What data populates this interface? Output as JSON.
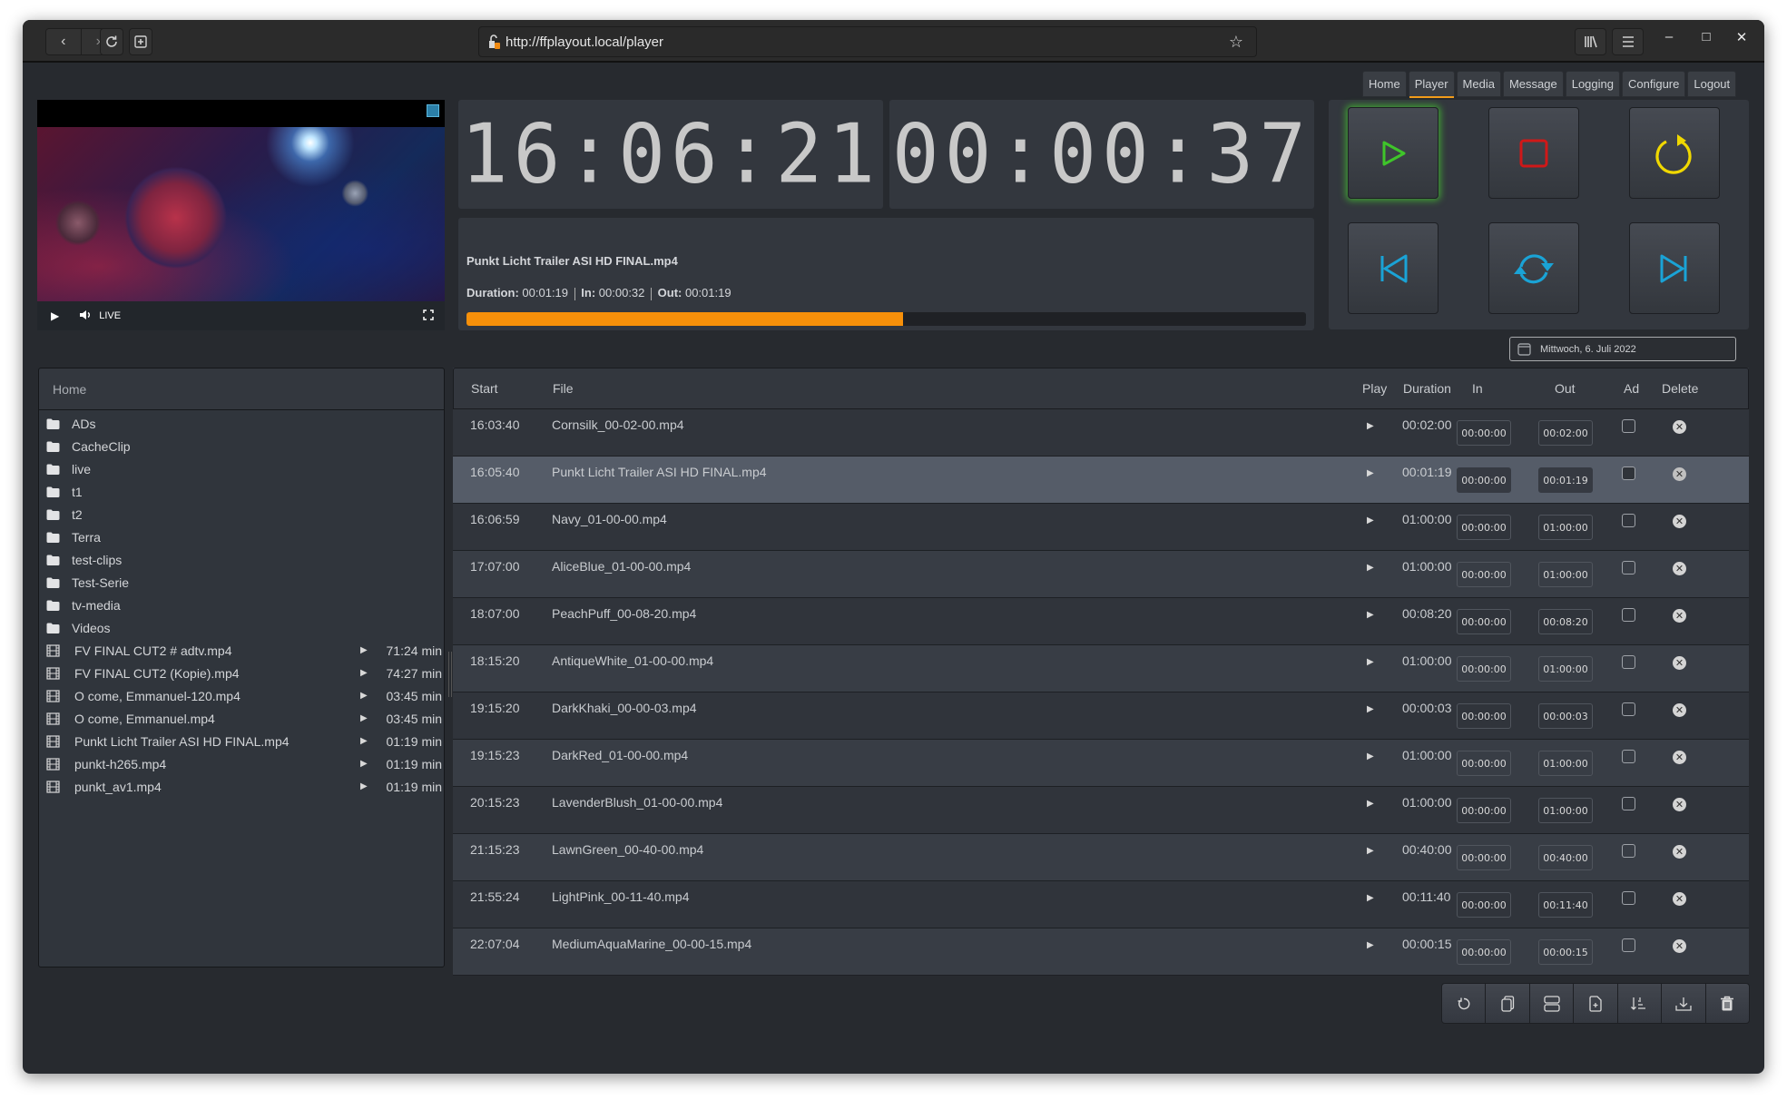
{
  "browser": {
    "url": "http://ffplayout.local/player",
    "nav": {
      "back": "back-icon",
      "forward": "forward-icon",
      "reload": "reload-icon",
      "new_tab": "new-tab-icon"
    },
    "right_icons": [
      "library-icon",
      "menu-icon"
    ],
    "window_controls": [
      "minimize",
      "maximize",
      "close"
    ]
  },
  "nav_tabs": [
    {
      "label": "Home",
      "active": false
    },
    {
      "label": "Player",
      "active": true
    },
    {
      "label": "Media",
      "active": false
    },
    {
      "label": "Message",
      "active": false
    },
    {
      "label": "Logging",
      "active": false
    },
    {
      "label": "Configure",
      "active": false
    },
    {
      "label": "Logout",
      "active": false
    }
  ],
  "preview": {
    "live_label": "LIVE"
  },
  "clocks": {
    "current_time": "16:06:21",
    "remaining": "00:00:37"
  },
  "now_playing": {
    "title": "Punkt Licht Trailer ASI HD FINAL.mp4",
    "duration_label": "Duration:",
    "duration": "00:01:19",
    "in_label": "In:",
    "in": "00:00:32",
    "out_label": "Out:",
    "out": "00:01:19",
    "progress_percent": 52
  },
  "controls": {
    "buttons": [
      {
        "name": "play",
        "color": "#3fc52a"
      },
      {
        "name": "stop",
        "color": "#d01818"
      },
      {
        "name": "restart",
        "color": "#f0d800"
      },
      {
        "name": "previous",
        "color": "#1aa3d6"
      },
      {
        "name": "reset",
        "color": "#1aa3d6"
      },
      {
        "name": "next",
        "color": "#1aa3d6"
      }
    ]
  },
  "date_picker": {
    "value": "Mittwoch, 6. Juli 2022"
  },
  "media_browser": {
    "path": "Home",
    "folders": [
      "ADs",
      "CacheClip",
      "live",
      "t1",
      "t2",
      "Terra",
      "test-clips",
      "Test-Serie",
      "tv-media",
      "Videos"
    ],
    "files": [
      {
        "name": "FV FINAL CUT2 # adtv.mp4",
        "duration": "71:24 min"
      },
      {
        "name": "FV FINAL CUT2 (Kopie).mp4",
        "duration": "74:27 min"
      },
      {
        "name": "O come, Emmanuel-120.mp4",
        "duration": "03:45 min"
      },
      {
        "name": "O come, Emmanuel.mp4",
        "duration": "03:45 min"
      },
      {
        "name": "Punkt Licht Trailer ASI HD FINAL.mp4",
        "duration": "01:19 min"
      },
      {
        "name": "punkt-h265.mp4",
        "duration": "01:19 min"
      },
      {
        "name": "punkt_av1.mp4",
        "duration": "01:19 min"
      }
    ]
  },
  "playlist": {
    "headers": {
      "start": "Start",
      "file": "File",
      "play": "Play",
      "duration": "Duration",
      "in": "In",
      "out": "Out",
      "ad": "Ad",
      "delete": "Delete"
    },
    "rows": [
      {
        "start": "16:03:40",
        "file": "Cornsilk_00-02-00.mp4",
        "duration": "00:02:00",
        "in": "00:00:00",
        "out": "00:02:00",
        "ad": false,
        "active": false
      },
      {
        "start": "16:05:40",
        "file": "Punkt Licht Trailer ASI HD FINAL.mp4",
        "duration": "00:01:19",
        "in": "00:00:00",
        "out": "00:01:19",
        "ad": false,
        "active": true
      },
      {
        "start": "16:06:59",
        "file": "Navy_01-00-00.mp4",
        "duration": "01:00:00",
        "in": "00:00:00",
        "out": "01:00:00",
        "ad": false,
        "active": false
      },
      {
        "start": "17:07:00",
        "file": "AliceBlue_01-00-00.mp4",
        "duration": "01:00:00",
        "in": "00:00:00",
        "out": "01:00:00",
        "ad": false,
        "active": false
      },
      {
        "start": "18:07:00",
        "file": "PeachPuff_00-08-20.mp4",
        "duration": "00:08:20",
        "in": "00:00:00",
        "out": "00:08:20",
        "ad": false,
        "active": false
      },
      {
        "start": "18:15:20",
        "file": "AntiqueWhite_01-00-00.mp4",
        "duration": "01:00:00",
        "in": "00:00:00",
        "out": "01:00:00",
        "ad": false,
        "active": false
      },
      {
        "start": "19:15:20",
        "file": "DarkKhaki_00-00-03.mp4",
        "duration": "00:00:03",
        "in": "00:00:00",
        "out": "00:00:03",
        "ad": false,
        "active": false
      },
      {
        "start": "19:15:23",
        "file": "DarkRed_01-00-00.mp4",
        "duration": "01:00:00",
        "in": "00:00:00",
        "out": "01:00:00",
        "ad": false,
        "active": false
      },
      {
        "start": "20:15:23",
        "file": "LavenderBlush_01-00-00.mp4",
        "duration": "01:00:00",
        "in": "00:00:00",
        "out": "01:00:00",
        "ad": false,
        "active": false
      },
      {
        "start": "21:15:23",
        "file": "LawnGreen_00-40-00.mp4",
        "duration": "00:40:00",
        "in": "00:00:00",
        "out": "00:40:00",
        "ad": false,
        "active": false
      },
      {
        "start": "21:55:24",
        "file": "LightPink_00-11-40.mp4",
        "duration": "00:11:40",
        "in": "00:00:00",
        "out": "00:11:40",
        "ad": false,
        "active": false
      },
      {
        "start": "22:07:04",
        "file": "MediumAquaMarine_00-00-15.mp4",
        "duration": "00:00:15",
        "in": "00:00:00",
        "out": "00:00:15",
        "ad": false,
        "active": false
      }
    ]
  },
  "playlist_toolbar": [
    "reset-playlist",
    "copy-playlist",
    "add-placeholder",
    "add-source",
    "generate-playlist",
    "save-playlist",
    "delete-playlist"
  ],
  "colors": {
    "accent": "#f39c1a",
    "progress": "#f7900a",
    "play": "#3fc52a",
    "stop": "#d01818",
    "restart": "#f0d800",
    "nav": "#1aa3d6"
  }
}
